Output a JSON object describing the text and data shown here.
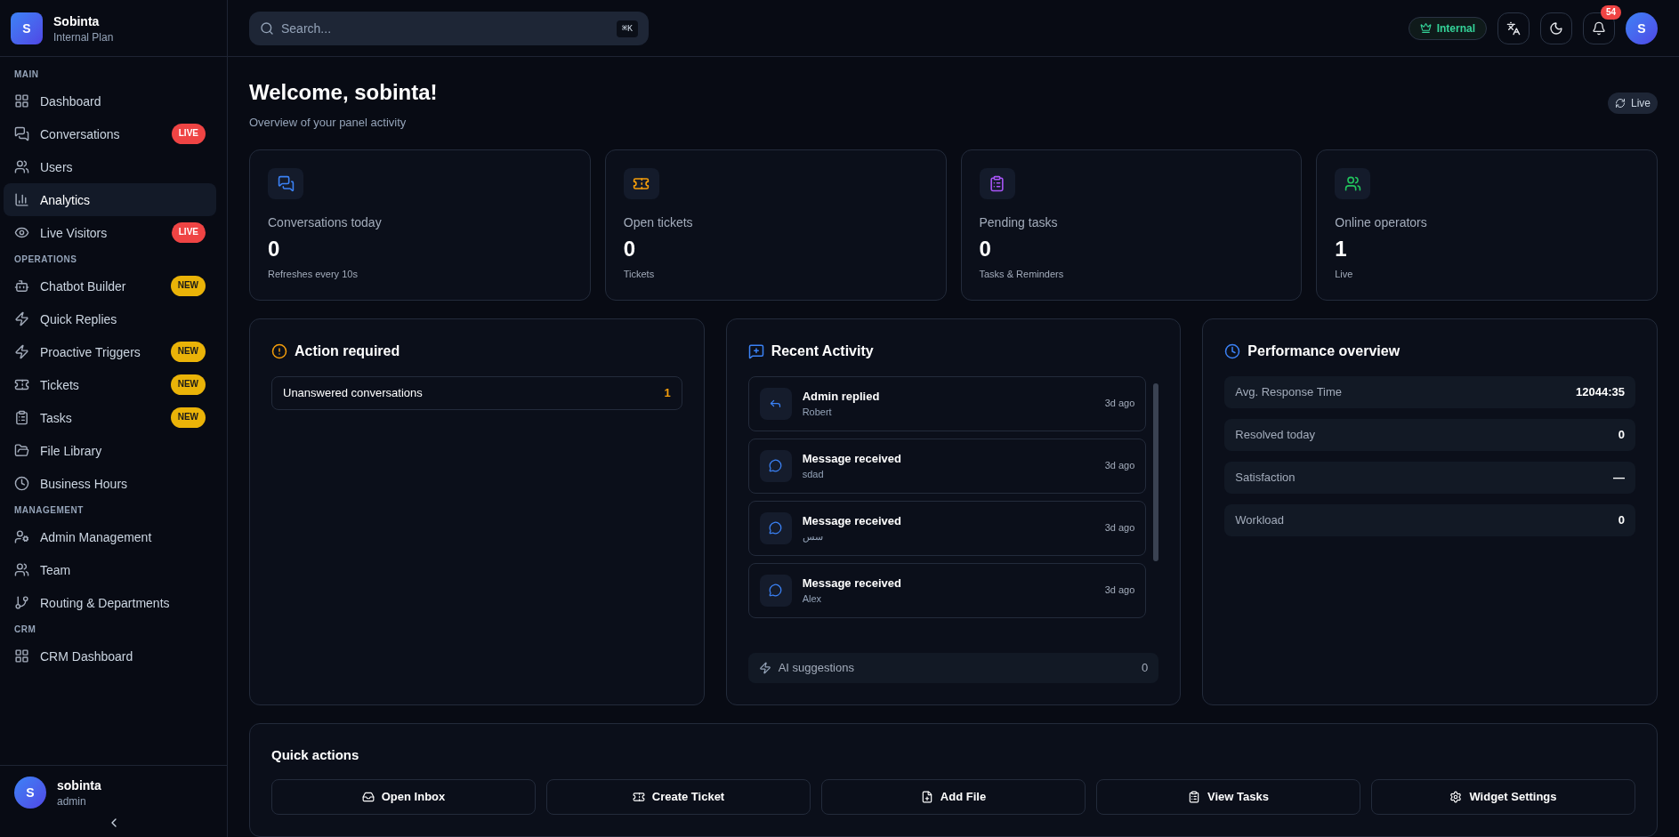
{
  "workspace": {
    "avatar": "S",
    "name": "Sobinta",
    "plan": "Internal Plan"
  },
  "sidebar": {
    "sections": [
      {
        "title": "MAIN",
        "items": [
          {
            "label": "Dashboard",
            "selected": false
          },
          {
            "label": "Conversations",
            "selected": false,
            "badge": {
              "text": "LIVE",
              "kind": "live"
            }
          },
          {
            "label": "Users",
            "selected": false
          },
          {
            "label": "Analytics",
            "selected": true
          },
          {
            "label": "Live Visitors",
            "selected": false,
            "badge": {
              "text": "LIVE",
              "kind": "live"
            }
          }
        ]
      },
      {
        "title": "OPERATIONS",
        "items": [
          {
            "label": "Chatbot Builder",
            "selected": false,
            "badge": {
              "text": "NEW",
              "kind": "new"
            }
          },
          {
            "label": "Quick Replies",
            "selected": false
          },
          {
            "label": "Proactive Triggers",
            "selected": false,
            "badge": {
              "text": "NEW",
              "kind": "new"
            }
          },
          {
            "label": "Tickets",
            "selected": false,
            "badge": {
              "text": "NEW",
              "kind": "new"
            }
          },
          {
            "label": "Tasks",
            "selected": false,
            "badge": {
              "text": "NEW",
              "kind": "new"
            }
          },
          {
            "label": "File Library",
            "selected": false
          },
          {
            "label": "Business Hours",
            "selected": false
          }
        ]
      },
      {
        "title": "MANAGEMENT",
        "items": [
          {
            "label": "Admin Management",
            "selected": false
          },
          {
            "label": "Team",
            "selected": false
          },
          {
            "label": "Routing & Departments",
            "selected": false
          }
        ]
      },
      {
        "title": "CRM",
        "items": [
          {
            "label": "CRM Dashboard",
            "selected": false
          }
        ]
      }
    ],
    "user": {
      "avatar": "S",
      "name": "sobinta",
      "role": "admin"
    }
  },
  "header": {
    "search": {
      "placeholder": "Search...",
      "shortcut": "⌘K"
    },
    "plan_badge": "Internal",
    "notifications": "54",
    "avatar": "S"
  },
  "page": {
    "title": "Welcome, sobinta!",
    "subtitle": "Overview of your panel activity",
    "live_button": "Live"
  },
  "stats": [
    {
      "label": "Conversations today",
      "value": "0",
      "note": "Refreshes every 10s",
      "color": "#3b82f6"
    },
    {
      "label": "Open tickets",
      "value": "0",
      "note": "Tickets",
      "color": "#f59e0b"
    },
    {
      "label": "Pending tasks",
      "value": "0",
      "note": "Tasks & Reminders",
      "color": "#a855f7"
    },
    {
      "label": "Online operators",
      "value": "1",
      "note": "Live",
      "color": "#22c55e"
    }
  ],
  "action_required": {
    "title": "Action required",
    "items": [
      {
        "label": "Unanswered conversations",
        "count": "1"
      }
    ]
  },
  "recent_activity": {
    "title": "Recent Activity",
    "items": [
      {
        "kind": "reply",
        "title": "Admin replied",
        "name": "Robert",
        "time": "3d ago"
      },
      {
        "kind": "message",
        "title": "Message received",
        "name": "sdad",
        "time": "3d ago"
      },
      {
        "kind": "message",
        "title": "Message received",
        "name": "سس",
        "time": "3d ago"
      },
      {
        "kind": "message",
        "title": "Message received",
        "name": "Alex",
        "time": "3d ago"
      }
    ],
    "ai_suggestions": {
      "label": "AI suggestions",
      "count": "0"
    }
  },
  "performance": {
    "title": "Performance overview",
    "rows": [
      {
        "label": "Avg. Response Time",
        "value": "12044:35"
      },
      {
        "label": "Resolved today",
        "value": "0"
      },
      {
        "label": "Satisfaction",
        "value": "—"
      },
      {
        "label": "Workload",
        "value": "0"
      }
    ]
  },
  "quick_actions": {
    "title": "Quick actions",
    "buttons": [
      "Open Inbox",
      "Create Ticket",
      "Add File",
      "View Tasks",
      "Widget Settings"
    ]
  }
}
